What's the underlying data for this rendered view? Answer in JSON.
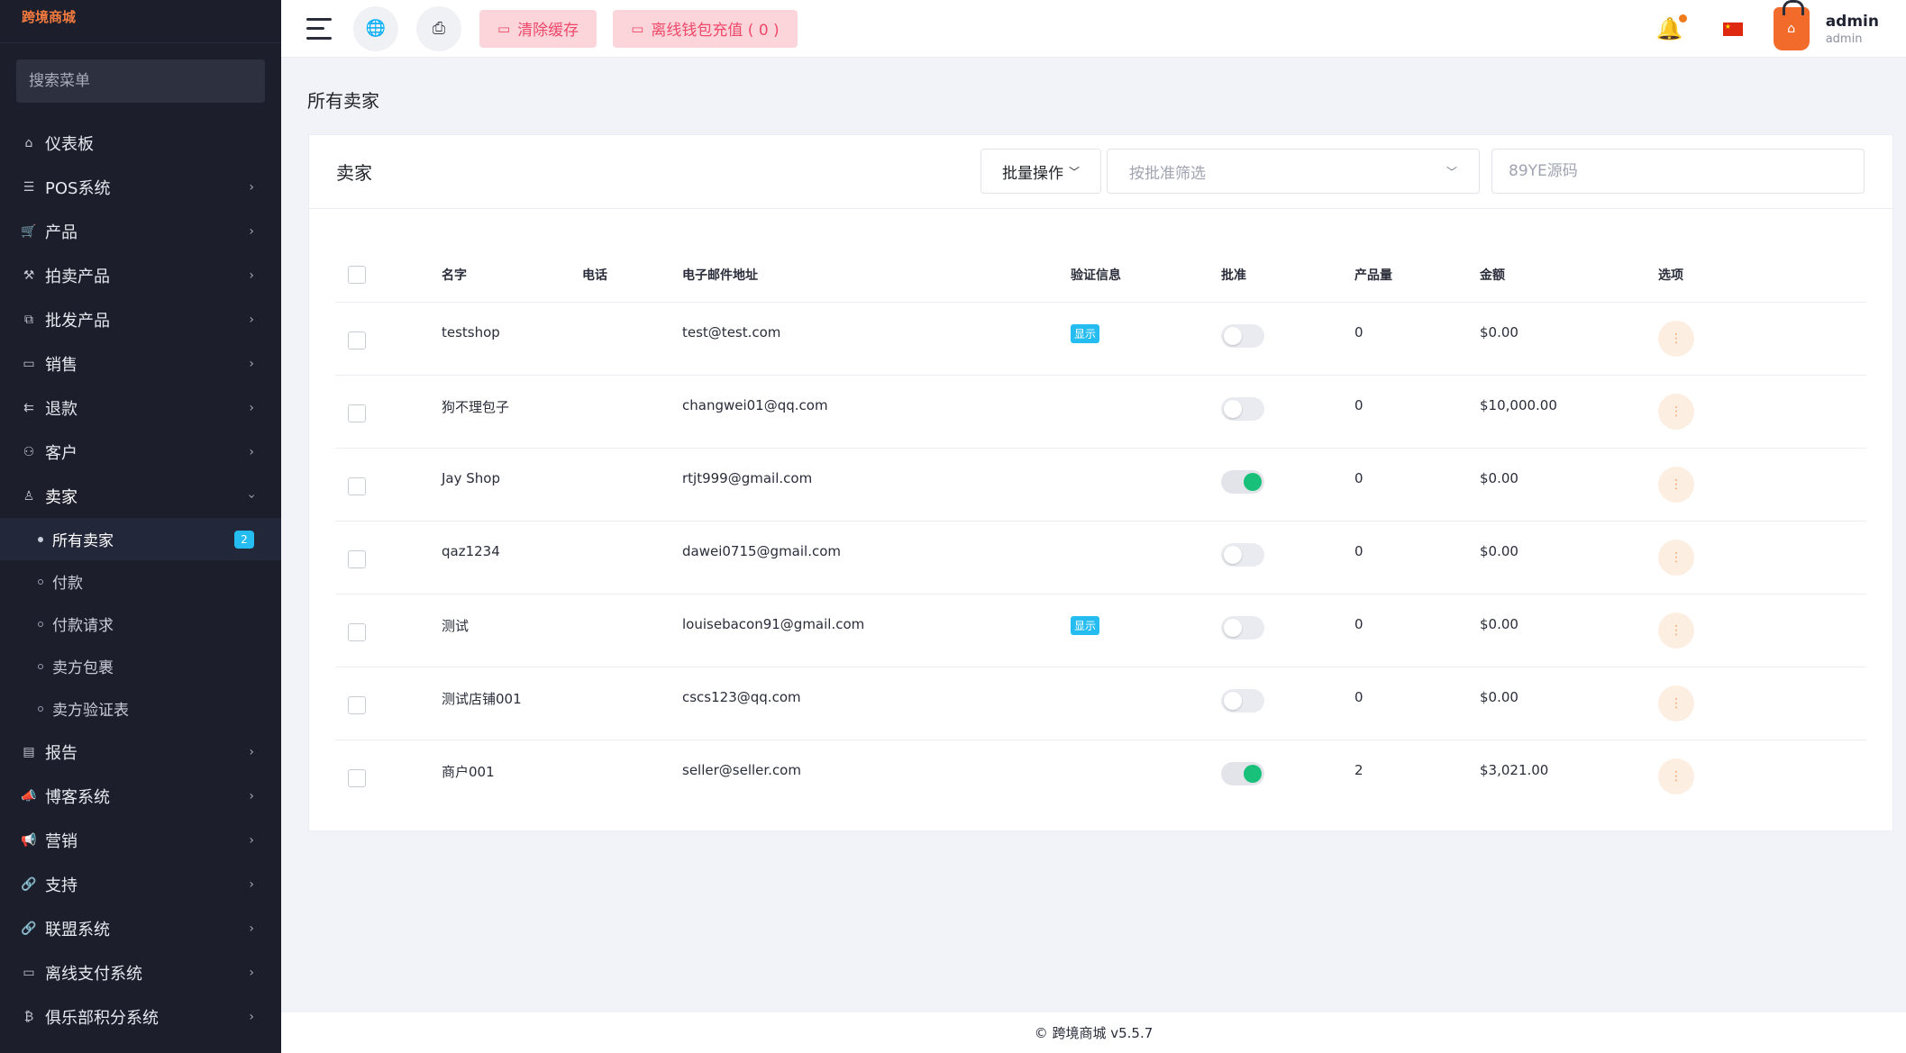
{
  "sidebar": {
    "brand": "跨境商城",
    "search_placeholder": "搜索菜单",
    "items": [
      {
        "label": "仪表板",
        "icon": "⌂"
      },
      {
        "label": "POS系统",
        "icon": "☰"
      },
      {
        "label": "产品",
        "icon": "🛒"
      },
      {
        "label": "拍卖产品",
        "icon": "⚒"
      },
      {
        "label": "批发产品",
        "icon": "⧉"
      },
      {
        "label": "销售",
        "icon": "▭"
      },
      {
        "label": "退款",
        "icon": "⇇"
      },
      {
        "label": "客户",
        "icon": "⚇"
      },
      {
        "label": "卖家",
        "icon": "♙"
      }
    ],
    "sub_items": [
      {
        "label": "所有卖家",
        "badge": "2"
      },
      {
        "label": "付款"
      },
      {
        "label": "付款请求"
      },
      {
        "label": "卖方包裹"
      },
      {
        "label": "卖方验证表"
      }
    ],
    "items_after": [
      {
        "label": "报告",
        "icon": "▤"
      },
      {
        "label": "博客系统",
        "icon": "📣"
      },
      {
        "label": "营销",
        "icon": "📢"
      },
      {
        "label": "支持",
        "icon": "🔗"
      },
      {
        "label": "联盟系统",
        "icon": "🔗"
      },
      {
        "label": "离线支付系统",
        "icon": "▭"
      },
      {
        "label": "俱乐部积分系统",
        "icon": "₿"
      }
    ]
  },
  "header": {
    "clear_cache": "清除缓存",
    "offline_wallet": "离线钱包充值 ( 0 )",
    "user_name": "admin",
    "user_role": "admin"
  },
  "page": {
    "title": "所有卖家",
    "card_title": "卖家",
    "bulk_action": "批量操作",
    "filter_placeholder": "按批准筛选",
    "search_placeholder": "89YE源码"
  },
  "table": {
    "headers": [
      "名字",
      "电话",
      "电子邮件地址",
      "验证信息",
      "批准",
      "产品量",
      "金额",
      "选项"
    ],
    "rows": [
      {
        "name": "testshop",
        "phone": "",
        "email": "test@test.com",
        "verify": "显示",
        "approved": false,
        "products": "0",
        "amount": "$0.00"
      },
      {
        "name": "狗不理包子",
        "phone": "",
        "email": "changwei01@qq.com",
        "verify": "",
        "approved": false,
        "products": "0",
        "amount": "$10,000.00"
      },
      {
        "name": "Jay Shop",
        "phone": "",
        "email": "rtjt999@gmail.com",
        "verify": "",
        "approved": true,
        "products": "0",
        "amount": "$0.00"
      },
      {
        "name": "qaz1234",
        "phone": "",
        "email": "dawei0715@gmail.com",
        "verify": "",
        "approved": false,
        "products": "0",
        "amount": "$0.00"
      },
      {
        "name": "测试",
        "phone": "",
        "email": "louisebacon91@gmail.com",
        "verify": "显示",
        "approved": false,
        "products": "0",
        "amount": "$0.00"
      },
      {
        "name": "测试店铺001",
        "phone": "",
        "email": "cscs123@qq.com",
        "verify": "",
        "approved": false,
        "products": "0",
        "amount": "$0.00"
      },
      {
        "name": "商户001",
        "phone": "",
        "email": "seller@seller.com",
        "verify": "",
        "approved": true,
        "products": "2",
        "amount": "$3,021.00"
      }
    ]
  },
  "footer": {
    "text": "© 跨境商城 v5.5.7"
  }
}
